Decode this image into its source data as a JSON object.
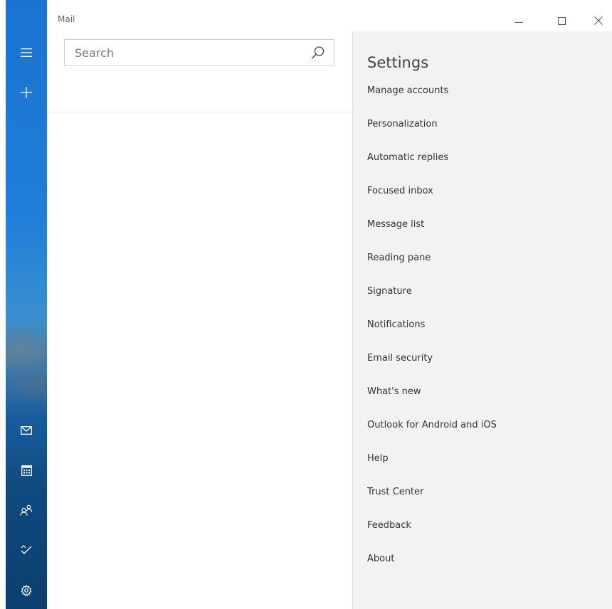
{
  "window": {
    "title": "Mail"
  },
  "search": {
    "placeholder": "Search"
  },
  "settings": {
    "title": "Settings",
    "items": [
      {
        "label": "Manage accounts"
      },
      {
        "label": "Personalization"
      },
      {
        "label": "Automatic replies"
      },
      {
        "label": "Focused inbox"
      },
      {
        "label": "Message list"
      },
      {
        "label": "Reading pane"
      },
      {
        "label": "Signature"
      },
      {
        "label": "Notifications"
      },
      {
        "label": "Email security"
      },
      {
        "label": "What's new"
      },
      {
        "label": "Outlook for Android and iOS"
      },
      {
        "label": "Help"
      },
      {
        "label": "Trust Center"
      },
      {
        "label": "Feedback"
      },
      {
        "label": "About"
      }
    ]
  },
  "rail": {
    "top": [
      "hamburger-menu-icon",
      "plus-icon"
    ],
    "bottom": [
      "mail-icon",
      "calendar-icon",
      "people-icon",
      "todo-icon",
      "gear-icon"
    ]
  },
  "colors": {
    "rail_top": "#1a73d0",
    "rail_bottom": "#0b3f6f",
    "panel_bg": "#f2f2f2"
  }
}
